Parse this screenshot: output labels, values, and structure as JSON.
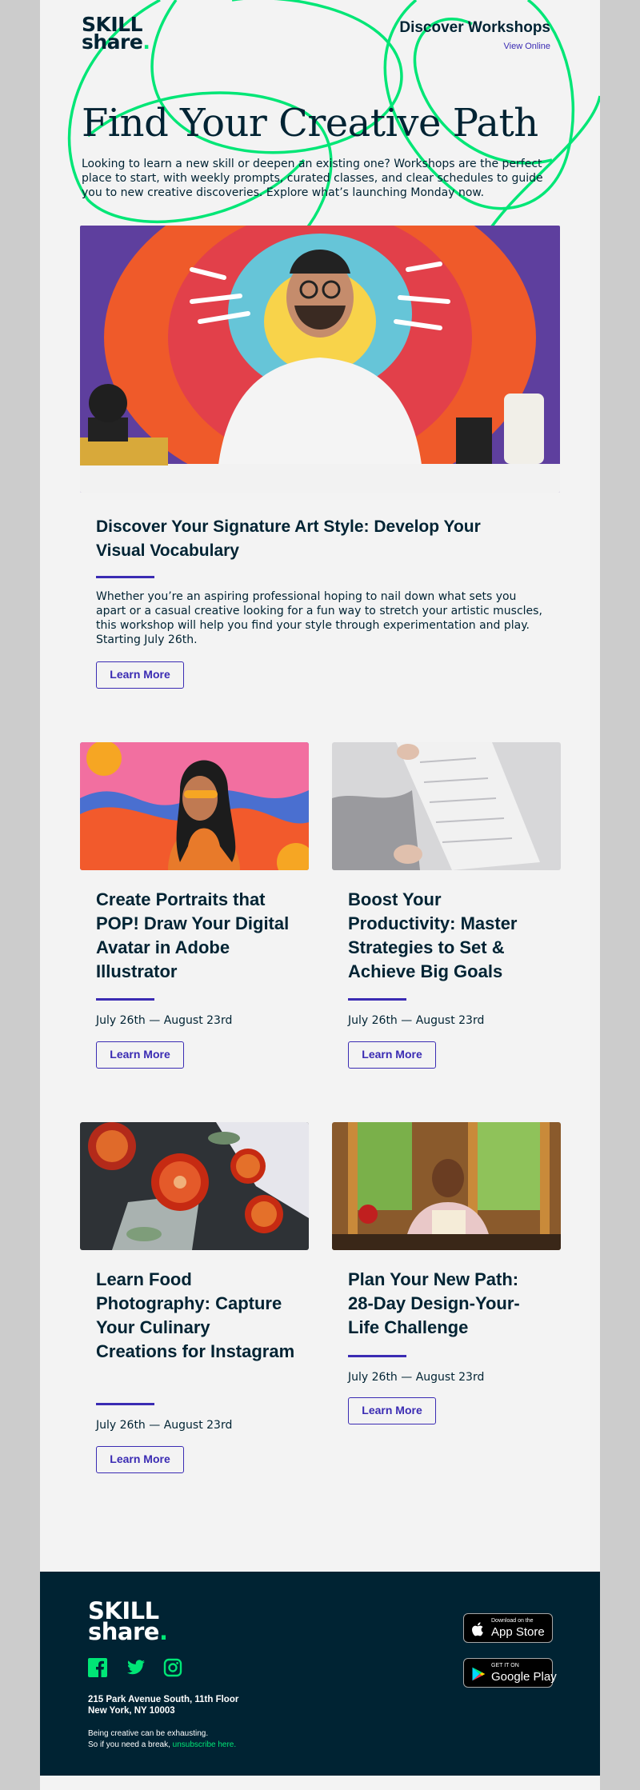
{
  "brand": {
    "logo_line1": "SKILL",
    "logo_line2": "share",
    "logo_dot": "."
  },
  "header": {
    "discover_label": "Discover Workshops",
    "view_online_label": "View Online"
  },
  "hero": {
    "title": "Find Your Creative Path",
    "text": "Looking to learn a new skill or deepen an existing one? Workshops are the perfect place to start, with weekly prompts, curated classes, and clear schedules to guide you to new creative discoveries. Explore what’s launching Monday now."
  },
  "feature": {
    "title": "Discover Your Signature Art Style: Develop Your Visual Vocabulary",
    "text": "Whether you’re an aspiring professional hoping to nail down what sets you apart or a casual creative looking for a fun way to stretch your artistic muscles, this workshop will help you find your style through experimentation and play. Starting July 26th.",
    "button_label": "Learn More"
  },
  "cards": [
    {
      "title": "Create Portraits that POP! Draw Your Digital Avatar in Adobe Illustrator",
      "date": "July 26th — August 23rd",
      "button_label": "Learn More"
    },
    {
      "title": "Boost Your Productivity: Master Strategies to Set & Achieve Big Goals",
      "date": "July 26th — August 23rd",
      "button_label": "Learn More"
    },
    {
      "title": "Learn Food Photography: Capture Your Culinary Creations for Instagram",
      "date": "July 26th — August 23rd",
      "button_label": "Learn More"
    },
    {
      "title": "Plan Your New Path: 28-Day Design-Your-Life Challenge",
      "date": "July 26th — August 23rd",
      "button_label": "Learn More"
    }
  ],
  "footer": {
    "logo_line1": "SKILL",
    "logo_line2": "share",
    "logo_dot": ".",
    "social_icons": [
      "facebook-icon",
      "twitter-icon",
      "instagram-icon"
    ],
    "address_line1": "215 Park Avenue South, 11th Floor",
    "address_line2": "New York, NY 10003",
    "note_line1": "Being creative can be exhausting.",
    "note_line2_prefix": "So if you need a break,",
    "unsubscribe_label": "unsubscribe here.",
    "app_store_small": "Download on the",
    "app_store_big": "App Store",
    "google_play_small": "GET IT ON",
    "google_play_big": "Google Play"
  },
  "colors": {
    "brand_navy": "#002333",
    "brand_green": "#00e676",
    "accent_purple": "#3a2bb3",
    "page_bg": "#f3f3f3",
    "outer_bg": "#cccccc"
  }
}
